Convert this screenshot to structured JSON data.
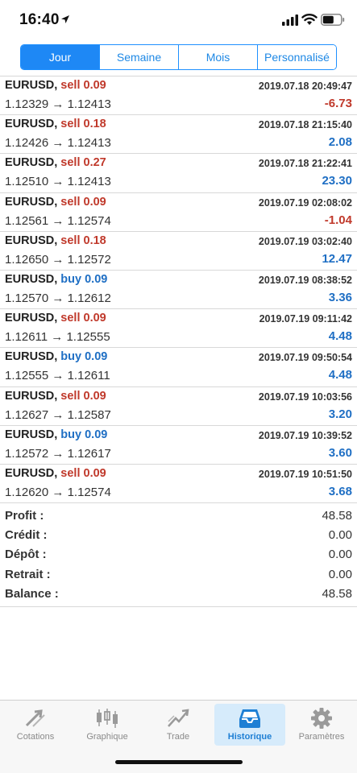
{
  "status_bar": {
    "time": "16:40"
  },
  "tabs_period": [
    {
      "label": "Jour",
      "active": true
    },
    {
      "label": "Semaine",
      "active": false
    },
    {
      "label": "Mois",
      "active": false
    },
    {
      "label": "Personnalisé",
      "active": false
    }
  ],
  "trades": [
    {
      "symbol": "EURUSD,",
      "side": "sell 0.09",
      "side_type": "sell",
      "open": "1.12329",
      "arrow": "→",
      "close": "1.12413",
      "time": "2019.07.18 20:49:47",
      "profit": "-6.73",
      "profit_type": "neg"
    },
    {
      "symbol": "EURUSD,",
      "side": "sell 0.18",
      "side_type": "sell",
      "open": "1.12426",
      "arrow": "→",
      "close": "1.12413",
      "time": "2019.07.18 21:15:40",
      "profit": "2.08",
      "profit_type": "pos"
    },
    {
      "symbol": "EURUSD,",
      "side": "sell 0.27",
      "side_type": "sell",
      "open": "1.12510",
      "arrow": "→",
      "close": "1.12413",
      "time": "2019.07.18 21:22:41",
      "profit": "23.30",
      "profit_type": "pos"
    },
    {
      "symbol": "EURUSD,",
      "side": "sell 0.09",
      "side_type": "sell",
      "open": "1.12561",
      "arrow": "→",
      "close": "1.12574",
      "time": "2019.07.19 02:08:02",
      "profit": "-1.04",
      "profit_type": "neg"
    },
    {
      "symbol": "EURUSD,",
      "side": "sell 0.18",
      "side_type": "sell",
      "open": "1.12650",
      "arrow": "→",
      "close": "1.12572",
      "time": "2019.07.19 03:02:40",
      "profit": "12.47",
      "profit_type": "pos"
    },
    {
      "symbol": "EURUSD,",
      "side": "buy 0.09",
      "side_type": "buy",
      "open": "1.12570",
      "arrow": "→",
      "close": "1.12612",
      "time": "2019.07.19 08:38:52",
      "profit": "3.36",
      "profit_type": "pos"
    },
    {
      "symbol": "EURUSD,",
      "side": "sell 0.09",
      "side_type": "sell",
      "open": "1.12611",
      "arrow": "→",
      "close": "1.12555",
      "time": "2019.07.19 09:11:42",
      "profit": "4.48",
      "profit_type": "pos"
    },
    {
      "symbol": "EURUSD,",
      "side": "buy 0.09",
      "side_type": "buy",
      "open": "1.12555",
      "arrow": "→",
      "close": "1.12611",
      "time": "2019.07.19 09:50:54",
      "profit": "4.48",
      "profit_type": "pos"
    },
    {
      "symbol": "EURUSD,",
      "side": "sell 0.09",
      "side_type": "sell",
      "open": "1.12627",
      "arrow": "→",
      "close": "1.12587",
      "time": "2019.07.19 10:03:56",
      "profit": "3.20",
      "profit_type": "pos"
    },
    {
      "symbol": "EURUSD,",
      "side": "buy 0.09",
      "side_type": "buy",
      "open": "1.12572",
      "arrow": "→",
      "close": "1.12617",
      "time": "2019.07.19 10:39:52",
      "profit": "3.60",
      "profit_type": "pos"
    },
    {
      "symbol": "EURUSD,",
      "side": "sell 0.09",
      "side_type": "sell",
      "open": "1.12620",
      "arrow": "→",
      "close": "1.12574",
      "time": "2019.07.19 10:51:50",
      "profit": "3.68",
      "profit_type": "pos"
    }
  ],
  "summary": [
    {
      "label": "Profit :",
      "value": "48.58"
    },
    {
      "label": "Crédit :",
      "value": "0.00"
    },
    {
      "label": "Dépôt :",
      "value": "0.00"
    },
    {
      "label": "Retrait :",
      "value": "0.00"
    },
    {
      "label": "Balance :",
      "value": "48.58"
    }
  ],
  "bottom_tabs": [
    {
      "label": "Cotations",
      "icon": "quotes-arrows-icon",
      "active": false
    },
    {
      "label": "Graphique",
      "icon": "candlestick-chart-icon",
      "active": false
    },
    {
      "label": "Trade",
      "icon": "trade-chart-icon",
      "active": false
    },
    {
      "label": "Historique",
      "icon": "inbox-tray-icon",
      "active": true
    },
    {
      "label": "Paramètres",
      "icon": "gear-icon",
      "active": false
    }
  ],
  "colors": {
    "accent": "#1e88f5",
    "sell": "#c0392b",
    "buy": "#1f6fc4",
    "loss": "#c0392b",
    "gain": "#1f6fc4",
    "tab_active_bg": "#d6ebfb"
  }
}
